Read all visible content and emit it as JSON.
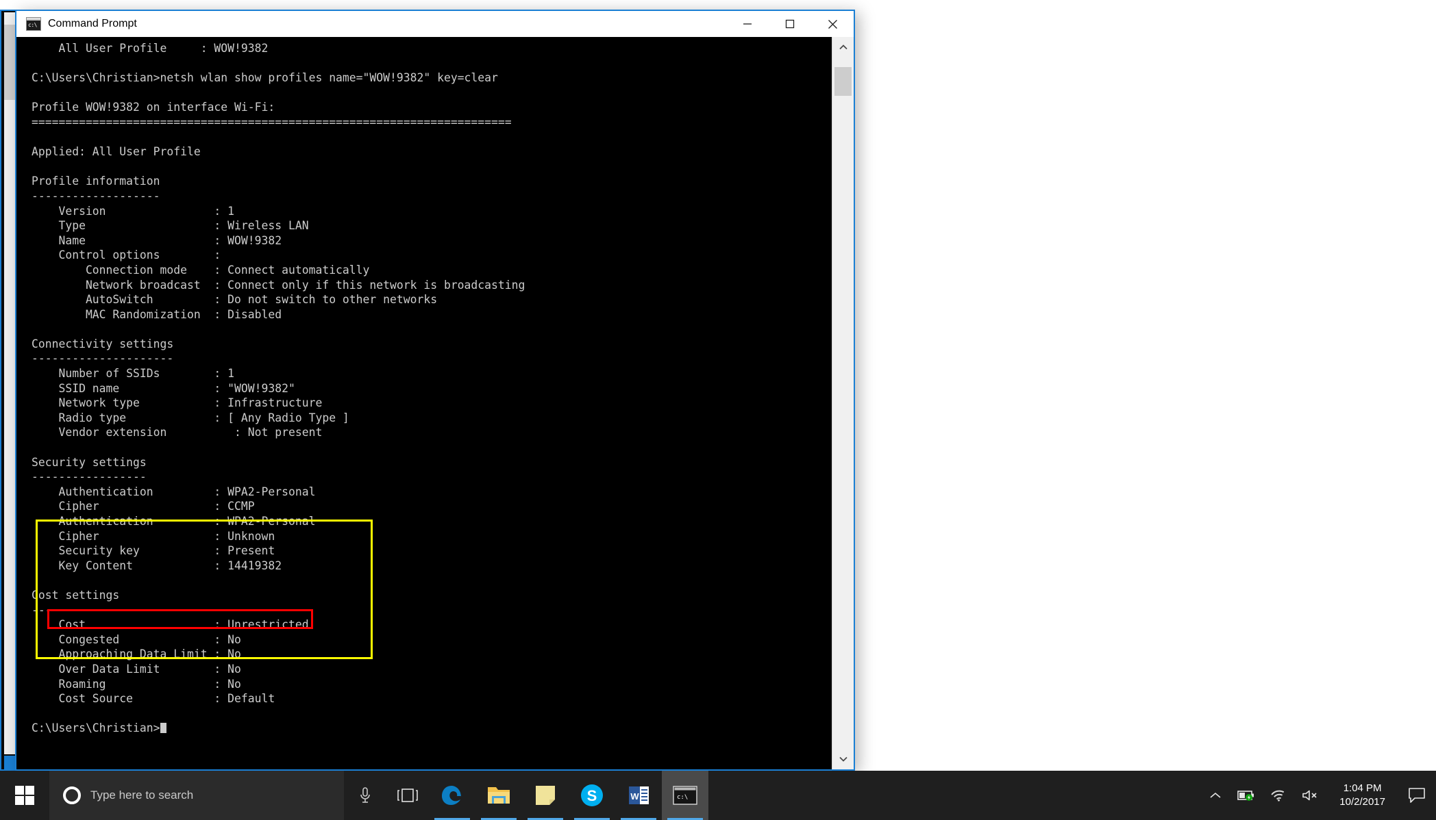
{
  "window": {
    "title": "Command Prompt",
    "icon": "command-prompt-icon",
    "minimize_label": "Minimize",
    "maximize_label": "Maximize",
    "close_label": "Close"
  },
  "terminal": {
    "content": "    All User Profile     : WOW!9382\n\nC:\\Users\\Christian>netsh wlan show profiles name=\"WOW!9382\" key=clear\n\nProfile WOW!9382 on interface Wi-Fi:\n=======================================================================\n\nApplied: All User Profile\n\nProfile information\n-------------------\n    Version                : 1\n    Type                   : Wireless LAN\n    Name                   : WOW!9382\n    Control options        :\n        Connection mode    : Connect automatically\n        Network broadcast  : Connect only if this network is broadcasting\n        AutoSwitch         : Do not switch to other networks\n        MAC Randomization  : Disabled\n\nConnectivity settings\n---------------------\n    Number of SSIDs        : 1\n    SSID name              : \"WOW!9382\"\n    Network type           : Infrastructure\n    Radio type             : [ Any Radio Type ]\n    Vendor extension          : Not present\n\nSecurity settings\n-----------------\n    Authentication         : WPA2-Personal\n    Cipher                 : CCMP\n    Authentication         : WPA2-Personal\n    Cipher                 : Unknown\n    Security key           : Present\n    Key Content            : 14419382\n\nCost settings\n-------------\n    Cost                   : Unrestricted\n    Congested              : No\n    Approaching Data Limit : No\n    Over Data Limit        : No\n    Roaming                : No\n    Cost Source            : Default\n\n",
    "prompt": "C:\\Users\\Christian>",
    "colors": {
      "background": "#000000",
      "foreground": "#cccccc"
    }
  },
  "annotations": {
    "security_block_highlight": {
      "name": "security-settings-highlight",
      "color": "#ffff00"
    },
    "key_content_highlight": {
      "name": "key-content-highlight",
      "color": "#ff0000",
      "value": "14419382"
    }
  },
  "scrollbar": {
    "up_arrow": "∧",
    "down_arrow": "∨"
  },
  "taskbar": {
    "start": "start-button",
    "search": {
      "placeholder": "Type here to search",
      "cortana": "cortana-icon",
      "microphone": "microphone-icon"
    },
    "task_view": "task-view-icon",
    "apps": [
      {
        "name": "microsoft-edge",
        "label": "Microsoft Edge",
        "running": true,
        "active": false
      },
      {
        "name": "file-explorer",
        "label": "File Explorer",
        "running": true,
        "active": false
      },
      {
        "name": "sticky-notes",
        "label": "Sticky Notes",
        "running": true,
        "active": false
      },
      {
        "name": "skype",
        "label": "Skype",
        "running": true,
        "active": false
      },
      {
        "name": "microsoft-word",
        "label": "Microsoft Word",
        "running": true,
        "active": false
      },
      {
        "name": "command-prompt",
        "label": "Command Prompt",
        "running": true,
        "active": true
      }
    ],
    "tray": {
      "show_hidden_icons": "chevron-up-icon",
      "battery": "battery-charging-icon",
      "network": "wifi-icon",
      "volume": "speaker-muted-icon",
      "time": "1:04 PM",
      "date": "10/2/2017",
      "action_center": "action-center-icon"
    }
  }
}
